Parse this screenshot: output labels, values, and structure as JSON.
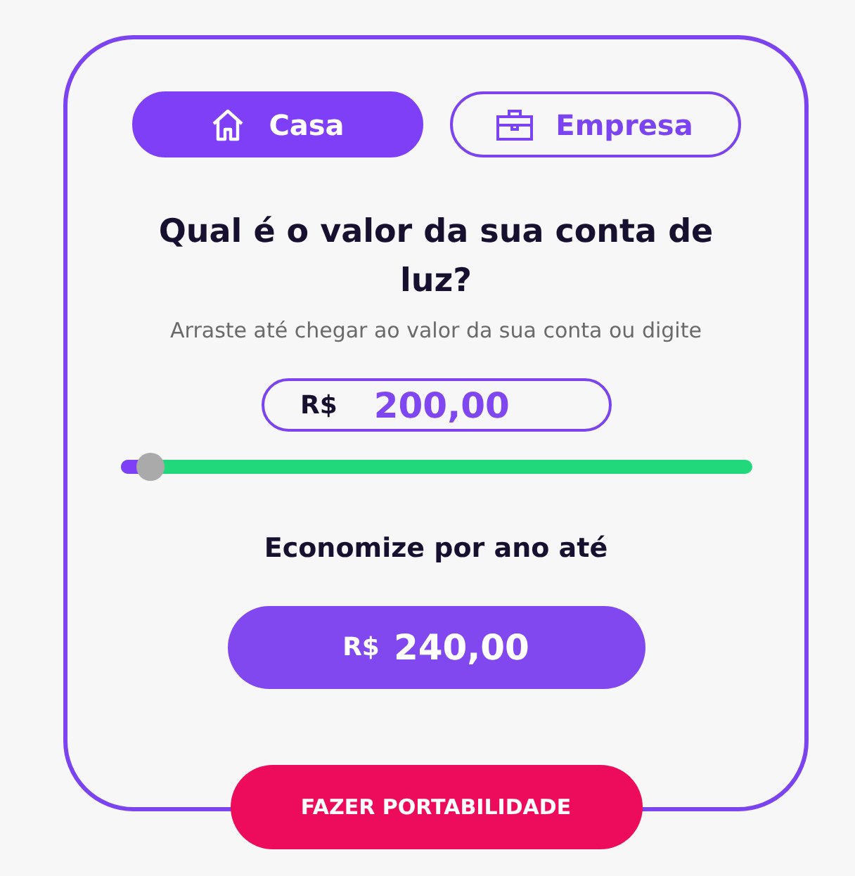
{
  "tabs": [
    {
      "label": "Casa",
      "selected": true
    },
    {
      "label": "Empresa",
      "selected": false
    }
  ],
  "question": "Qual é o valor da sua conta de luz?",
  "hint": "Arraste até chegar ao valor da sua conta ou digite",
  "bill": {
    "currency": "R$",
    "value": "200,00"
  },
  "slider": {
    "level": 0.03
  },
  "savings_label": "Economize por ano até",
  "savings": {
    "currency": "R$",
    "value": "240,00"
  },
  "cta": "FAZER PORTABILIDADE"
}
